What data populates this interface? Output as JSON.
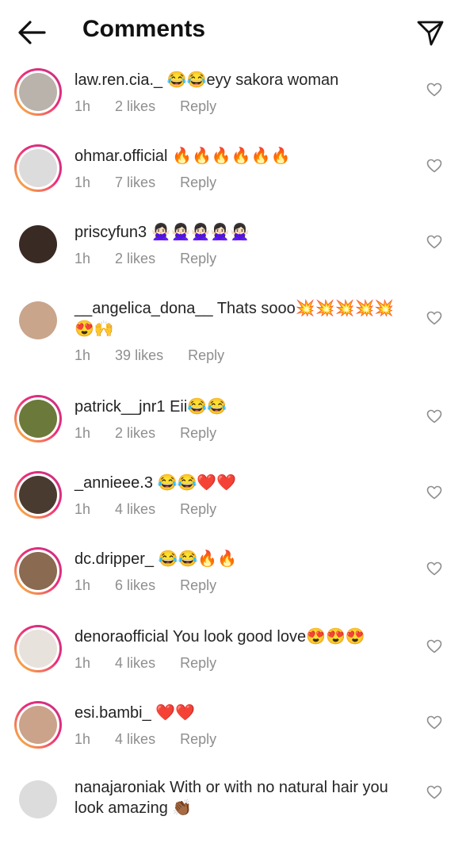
{
  "header": {
    "title": "Comments"
  },
  "comments": [
    {
      "username": "law.ren.cia._",
      "text": "😂😂eyy sakora woman",
      "time": "1h",
      "likes": "2 likes",
      "reply": "Reply",
      "avatar_color": "#b9b3ac",
      "ring": true
    },
    {
      "username": "ohmar.official",
      "text": "🔥🔥🔥🔥🔥🔥",
      "time": "1h",
      "likes": "7 likes",
      "reply": "Reply",
      "avatar_color": "#dcdcdc",
      "ring": true
    },
    {
      "username": "priscyfun3",
      "text": "🙅🏻‍♀️🙅🏻‍♀️🙅🏻‍♀️🙅🏻‍♀️🙅🏻‍♀️",
      "time": "1h",
      "likes": "2 likes",
      "reply": "Reply",
      "avatar_color": "#3a2a24",
      "ring": false
    },
    {
      "username": "__angelica_dona__",
      "text": "Thats sooo💥💥💥💥💥😍🙌",
      "time": "1h",
      "likes": "39 likes",
      "reply": "Reply",
      "avatar_color": "#c9a58c",
      "ring": false
    },
    {
      "username": "patrick__jnr1",
      "text": "Eii😂😂",
      "time": "1h",
      "likes": "2 likes",
      "reply": "Reply",
      "avatar_color": "#6b7a3a",
      "ring": true
    },
    {
      "username": "_annieee.3",
      "text": "😂😂❤️❤️",
      "time": "1h",
      "likes": "4 likes",
      "reply": "Reply",
      "avatar_color": "#4a3b30",
      "ring": true
    },
    {
      "username": "dc.dripper_",
      "text": "😂😂🔥🔥",
      "time": "1h",
      "likes": "6 likes",
      "reply": "Reply",
      "avatar_color": "#8a6a50",
      "ring": true
    },
    {
      "username": "denoraofficial",
      "text": "You look good love😍😍😍",
      "time": "1h",
      "likes": "4 likes",
      "reply": "Reply",
      "avatar_color": "#e8e2dc",
      "ring": true
    },
    {
      "username": "esi.bambi_",
      "text": "❤️❤️",
      "time": "1h",
      "likes": "4 likes",
      "reply": "Reply",
      "avatar_color": "#caa38a",
      "ring": true
    },
    {
      "username": "nanajaroniak",
      "text": "With or with no natural hair you look amazing 👏🏾",
      "time": "",
      "likes": "",
      "reply": "",
      "avatar_color": "#dcdcdc",
      "ring": false
    }
  ]
}
